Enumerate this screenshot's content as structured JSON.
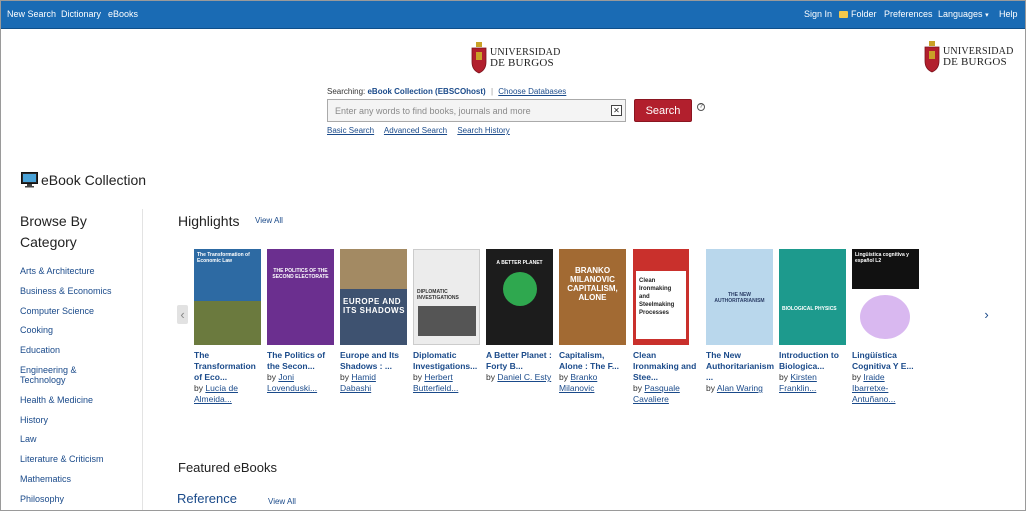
{
  "topnav": {
    "new_search": "New Search",
    "dictionary": "Dictionary",
    "ebooks": "eBooks",
    "sign_in": "Sign In",
    "folder": "Folder",
    "preferences": "Preferences",
    "languages": "Languages",
    "languages_caret": "▾",
    "help": "Help"
  },
  "logo": {
    "line1": "UNIVERSIDAD",
    "line2": "DE BURGOS"
  },
  "search": {
    "searching_label": "Searching:",
    "database": "eBook Collection (EBSCOhost)",
    "separator": "|",
    "choose_databases": "Choose Databases",
    "placeholder": "Enter any words to find books, journals and more",
    "clear_glyph": "✕",
    "button": "Search",
    "help_glyph": "?",
    "basic": "Basic Search",
    "advanced": "Advanced Search",
    "history": "Search History"
  },
  "collection_title": "eBook Collection",
  "browse_title": "Browse By Category",
  "categories": [
    "Arts & Architecture",
    "Business & Economics",
    "Computer Science",
    "Cooking",
    "Education",
    "Engineering & Technology",
    "Health & Medicine",
    "History",
    "Law",
    "Literature & Criticism",
    "Mathematics",
    "Philosophy"
  ],
  "highlights": {
    "title": "Highlights",
    "view_all": "View All",
    "prev_glyph": "‹",
    "next_glyph": "›",
    "books": [
      {
        "title": "The Transformation of Eco...",
        "by": "by",
        "author": "Lucía de Almeida...",
        "cover_color": "#2d6aa3",
        "cover_text": "The Transformation of Economic Law"
      },
      {
        "title": "The Politics of the Secon...",
        "by": "by",
        "author": "Joni Lovenduski...",
        "cover_color": "#6b2f8f",
        "cover_text": "THE POLITICS OF THE SECOND ELECTORATE"
      },
      {
        "title": "Europe and Its Shadows : ...",
        "by": "by",
        "author": "Hamid Dabashi",
        "cover_color": "#3e5270",
        "cover_text": "EUROPE AND ITS SHADOWS"
      },
      {
        "title": "Diplomatic Investigations...",
        "by": "by",
        "author": "Herbert Butterfield...",
        "cover_color": "#ececec",
        "cover_text": "DIPLOMATIC INVESTIGATIONS"
      },
      {
        "title": "A Better Planet : Forty B...",
        "by": "by",
        "author": "Daniel C. Esty",
        "cover_color": "#1c1c1c",
        "cover_text": "A BETTER PLANET"
      },
      {
        "title": "Capitalism, Alone : The F...",
        "by": "by",
        "author": "Branko Milanovic",
        "cover_color": "#a26a33",
        "cover_text": "BRANKO MILANOVIC CAPITALISM, ALONE"
      },
      {
        "title": "Clean Ironmaking and Stee...",
        "by": "by",
        "author": "Pasquale Cavaliere",
        "cover_color": "#c9302c",
        "cover_text": "Clean Ironmaking and Steelmaking Processes"
      },
      {
        "title": "The New Authoritarianism ...",
        "by": "by",
        "author": "Alan Waring",
        "cover_color": "#b9d7ec",
        "cover_text": "THE NEW AUTHORITARIANISM"
      },
      {
        "title": "Introduction to Biologica...",
        "by": "by",
        "author": "Kirsten Franklin...",
        "cover_color": "#1d9a8d",
        "cover_text": "BIOLOGICAL PHYSICS"
      },
      {
        "title": "Lingüística Cognitiva Y E...",
        "by": "by",
        "author": "Iraide Ibarretxe-Antuñano...",
        "cover_color": "#ffffff",
        "cover_text": "Lingüística cognitiva y español L2"
      }
    ]
  },
  "featured_title": "Featured eBooks",
  "reference": {
    "title": "Reference",
    "view_all": "View All"
  }
}
